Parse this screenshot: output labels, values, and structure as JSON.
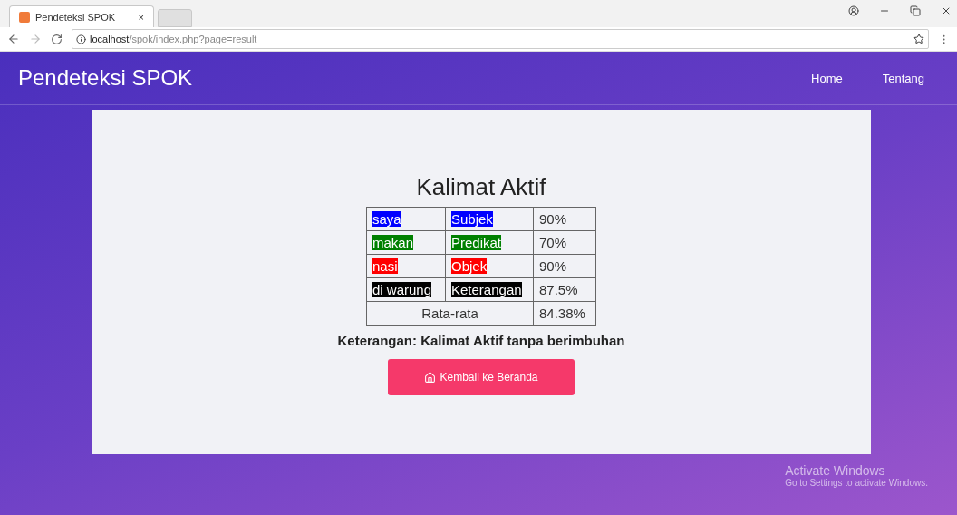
{
  "browser": {
    "tab_title": "Pendeteksi SPOK",
    "tab_close": "×",
    "address": "**localhost**/spok/index.php?page=result"
  },
  "navbar": {
    "brand": "Pendeteksi SPOK",
    "links": [
      "Home",
      "Tentang"
    ]
  },
  "result": {
    "title": "Kalimat Aktif",
    "rows": [
      {
        "word": "saya",
        "role": "Subjek",
        "score": "90%",
        "color": "#0000ff"
      },
      {
        "word": "makan",
        "role": "Predikat",
        "score": "70%",
        "color": "#008000"
      },
      {
        "word": "nasi",
        "role": "Objek",
        "score": "90%",
        "color": "#ff0000"
      },
      {
        "word": "di warung",
        "role": "Keterangan",
        "score": "87.5%",
        "color": "#000000"
      }
    ],
    "average_label": "Rata-rata",
    "average": "84.38%",
    "note": "Keterangan: Kalimat Aktif tanpa berimbuhan",
    "button": "Kembali ke Beranda"
  },
  "os_notice": {
    "title": "Activate Windows",
    "text": "Go to Settings to activate Windows."
  }
}
